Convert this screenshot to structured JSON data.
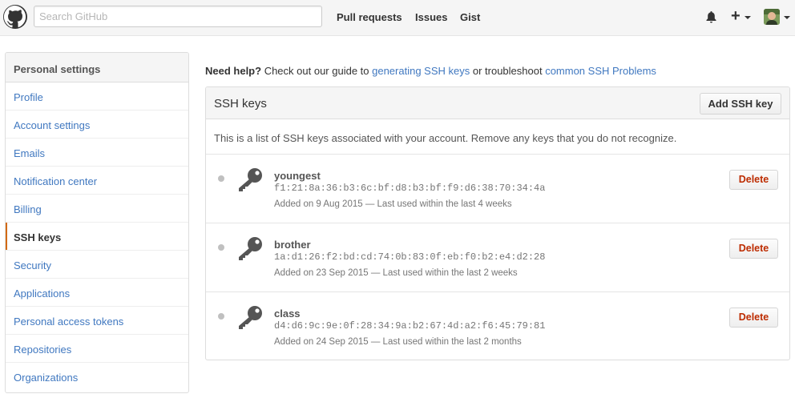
{
  "header": {
    "search_placeholder": "Search GitHub",
    "nav": [
      "Pull requests",
      "Issues",
      "Gist"
    ],
    "icons": [
      "github-logo",
      "bell-icon",
      "plus-icon",
      "avatar"
    ]
  },
  "sidebar": {
    "title": "Personal settings",
    "items": [
      {
        "label": "Profile"
      },
      {
        "label": "Account settings"
      },
      {
        "label": "Emails"
      },
      {
        "label": "Notification center"
      },
      {
        "label": "Billing"
      },
      {
        "label": "SSH keys",
        "active": true
      },
      {
        "label": "Security"
      },
      {
        "label": "Applications"
      },
      {
        "label": "Personal access tokens"
      },
      {
        "label": "Repositories"
      },
      {
        "label": "Organizations"
      }
    ]
  },
  "help": {
    "bold": "Need help?",
    "text1": " Check out our guide to ",
    "link1": "generating SSH keys",
    "text2": " or troubleshoot ",
    "link2": "common SSH Problems"
  },
  "panel": {
    "title": "SSH keys",
    "add_button": "Add SSH key",
    "description": "This is a list of SSH keys associated with your account. Remove any keys that you do not recognize.",
    "delete_label": "Delete",
    "keys": [
      {
        "title": "youngest",
        "fingerprint": "f1:21:8a:36:b3:6c:bf:d8:b3:bf:f9:d6:38:70:34:4a",
        "meta": "Added on 9 Aug 2015 — Last used within the last 4 weeks"
      },
      {
        "title": "brother",
        "fingerprint": "1a:d1:26:f2:bd:cd:74:0b:83:0f:eb:f0:b2:e4:d2:28",
        "meta": "Added on 23 Sep 2015 — Last used within the last 2 weeks"
      },
      {
        "title": "class",
        "fingerprint": "d4:d6:9c:9e:0f:28:34:9a:b2:67:4d:a2:f6:45:79:81",
        "meta": "Added on 24 Sep 2015 — Last used within the last 2 months"
      }
    ]
  },
  "colors": {
    "link": "#4078c0",
    "active_marker": "#d26911",
    "danger": "#bd2c00"
  }
}
